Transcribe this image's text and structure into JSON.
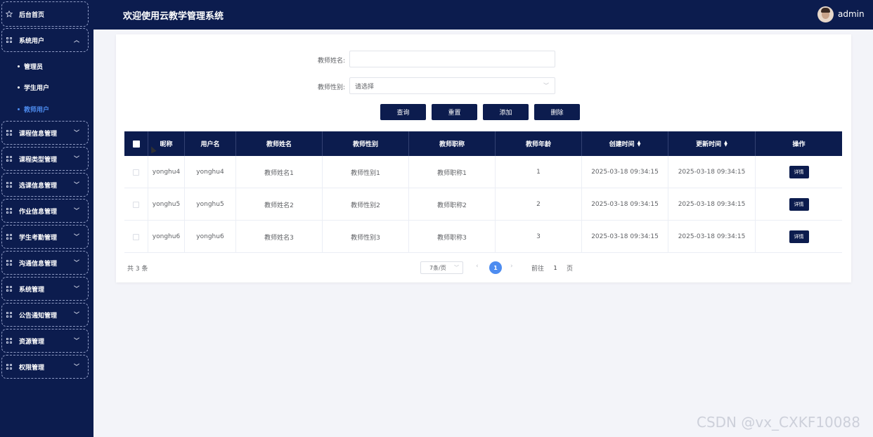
{
  "header": {
    "title": "欢迎使用云教学管理系统",
    "user": "admin"
  },
  "sidebar": {
    "home": "后台首页",
    "system_user": {
      "label": "系统用户",
      "children": [
        "管理员",
        "学生用户",
        "教师用户"
      ],
      "active_child": "教师用户"
    },
    "menus": [
      "课程信息管理",
      "课程类型管理",
      "选课信息管理",
      "作业信息管理",
      "学生考勤管理",
      "沟通信息管理",
      "系统管理",
      "公告通知管理",
      "资源管理",
      "权限管理"
    ]
  },
  "form": {
    "name_label": "教师姓名:",
    "name_value": "",
    "gender_label": "教师性别:",
    "gender_placeholder": "请选择"
  },
  "buttons": {
    "query": "查询",
    "reset": "重置",
    "add": "添加",
    "delete": "删除"
  },
  "table": {
    "columns": [
      "昵称",
      "用户名",
      "教师姓名",
      "教师性别",
      "教师职称",
      "教师年龄",
      "创建时间",
      "更新时间",
      "操作"
    ],
    "rows": [
      {
        "nickname": "yonghu4",
        "username": "yonghu4",
        "name": "教师姓名1",
        "gender": "教师性别1",
        "title": "教师职称1",
        "age": "1",
        "created": "2025-03-18 09:34:15",
        "updated": "2025-03-18 09:34:15",
        "action": "详情"
      },
      {
        "nickname": "yonghu5",
        "username": "yonghu5",
        "name": "教师姓名2",
        "gender": "教师性别2",
        "title": "教师职称2",
        "age": "2",
        "created": "2025-03-18 09:34:15",
        "updated": "2025-03-18 09:34:15",
        "action": "详情"
      },
      {
        "nickname": "yonghu6",
        "username": "yonghu6",
        "name": "教师姓名3",
        "gender": "教师性别3",
        "title": "教师职称3",
        "age": "3",
        "created": "2025-03-18 09:34:15",
        "updated": "2025-03-18 09:34:15",
        "action": "详情"
      }
    ]
  },
  "pagination": {
    "total": "共 3 条",
    "page_size": "7条/页",
    "prev": "‹",
    "current_page": "1",
    "next": "›",
    "goto_label": "前往",
    "goto_value": "1",
    "page_unit": "页"
  },
  "watermark": "CSDN @vx_CXKF10088",
  "colors": {
    "navy": "#0c1c4e",
    "accent": "#4d8cf0",
    "background": "#f3f4f9"
  }
}
